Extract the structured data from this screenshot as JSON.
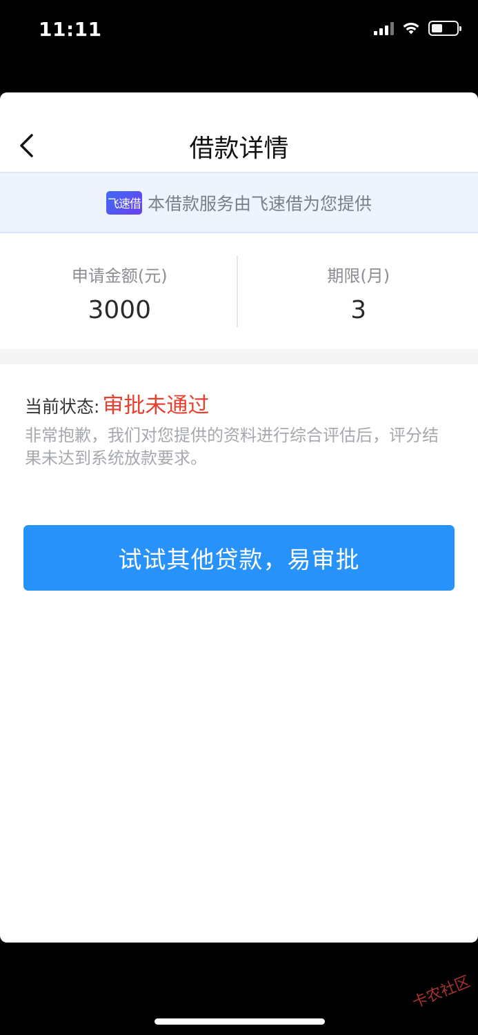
{
  "status_bar": {
    "time": "11:11",
    "battery_level": 0.45
  },
  "nav": {
    "title": "借款详情"
  },
  "provider_banner": {
    "logo_text": "飞速借",
    "text": "本借款服务由飞速借为您提供"
  },
  "loan": {
    "amount_label": "申请金额(元)",
    "amount_value": "3000",
    "term_label": "期限(月)",
    "term_value": "3"
  },
  "status": {
    "label": "当前状态:",
    "value": "审批未通过",
    "description": "非常抱歉，我们对您提供的资料进行综合评估后，评分结果未达到系统放款要求。"
  },
  "cta": {
    "label": "试试其他贷款，易审批"
  },
  "watermark": {
    "text": "卡农社区"
  },
  "colors": {
    "accent_blue": "#2892fb",
    "status_red": "#e8402f",
    "banner_bg": "#eef4fd"
  }
}
